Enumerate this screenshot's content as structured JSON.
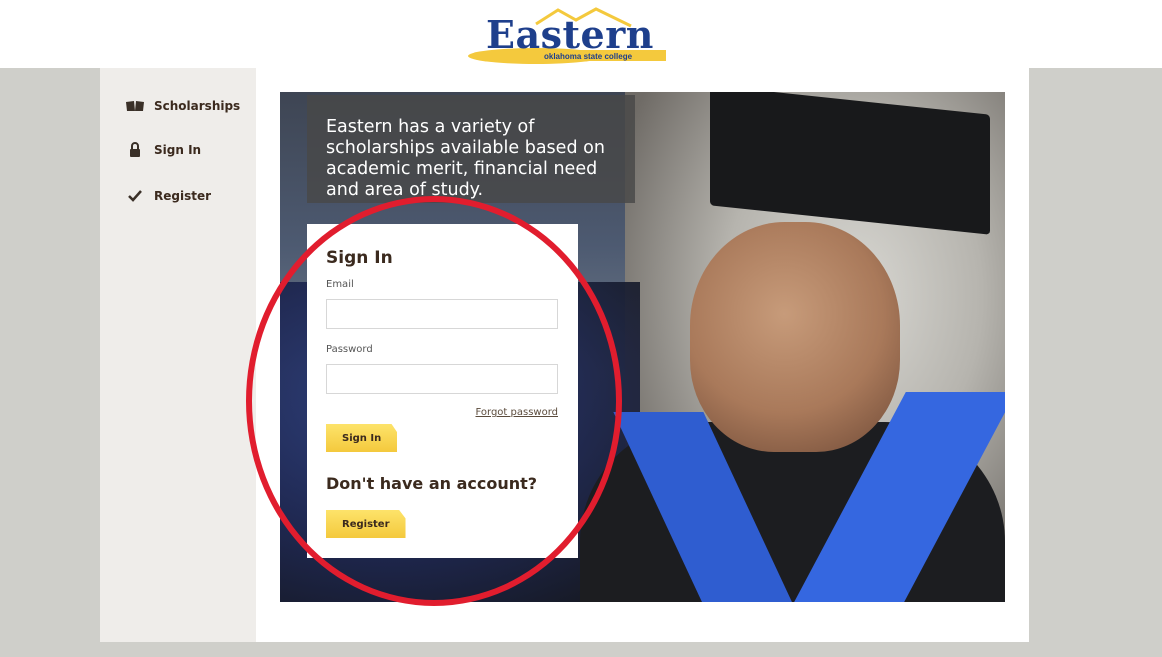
{
  "header": {
    "logo_word": "Eastern",
    "logo_sub": "oklahoma state college"
  },
  "sidebar": {
    "items": [
      {
        "label": "Scholarships",
        "icon": "book-icon"
      },
      {
        "label": "Sign In",
        "icon": "lock-icon"
      },
      {
        "label": "Register",
        "icon": "checkmark-icon"
      }
    ]
  },
  "hero": {
    "caption": "Eastern has a variety of scholarships available based on academic merit, financial need and area of study."
  },
  "signin": {
    "title": "Sign In",
    "email_label": "Email",
    "email_value": "",
    "password_label": "Password",
    "password_value": "",
    "forgot_label": "Forgot password",
    "signin_button": "Sign In",
    "no_account": "Don't have an account?",
    "register_button": "Register"
  },
  "colors": {
    "brand_blue": "#1e3f8c",
    "brand_gold": "#f4c93d",
    "text_brown": "#3b2a1e",
    "highlight_red": "#e11d2e",
    "band_gray": "#cfcfca"
  }
}
